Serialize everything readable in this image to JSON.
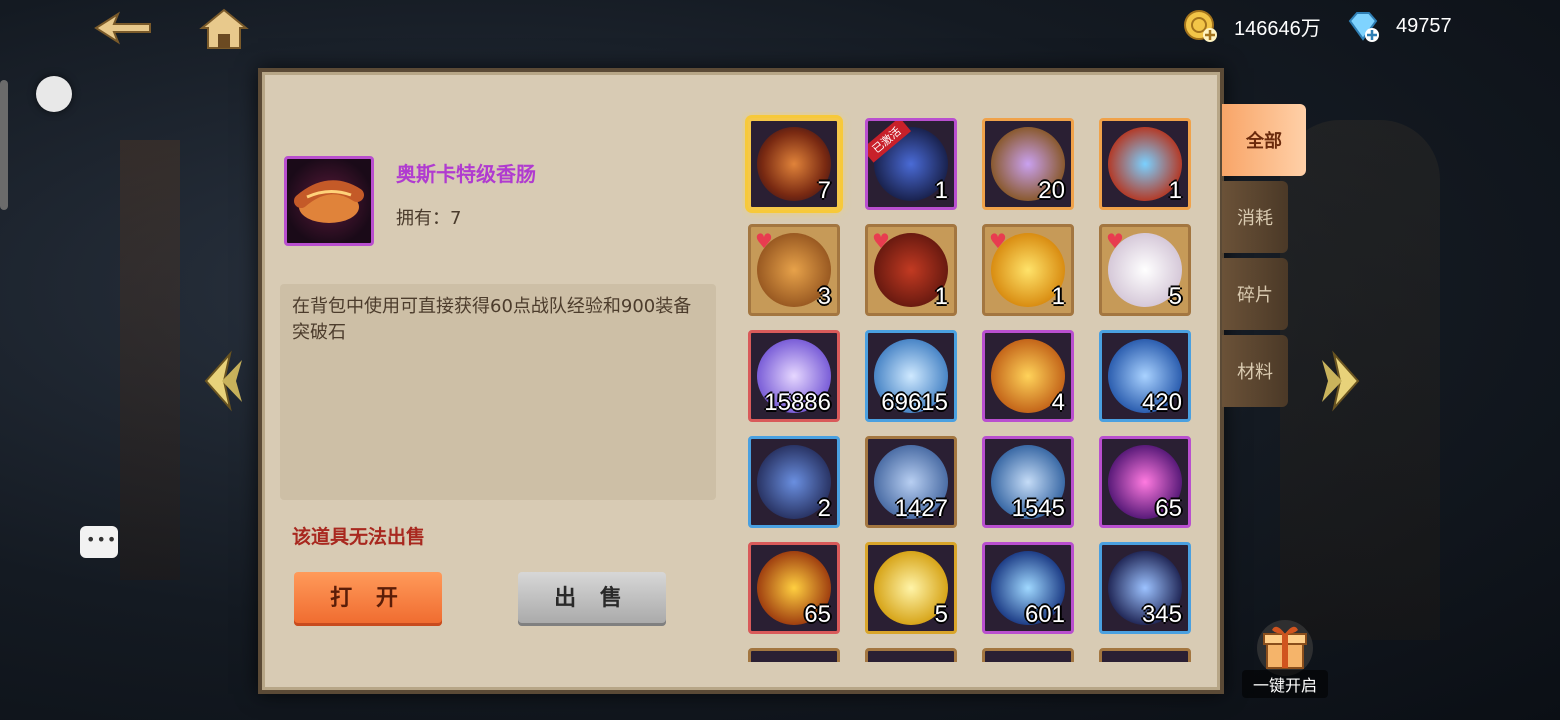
{
  "currency": {
    "gold": "146646万",
    "diamond": "49757"
  },
  "selected_item": {
    "name": "奥斯卡特级香肠",
    "owned_label": "拥有：7",
    "description": "在背包中使用可直接获得60点战队经验和900装备突破石",
    "sell_note": "该道具无法出售"
  },
  "actions": {
    "open": "打 开",
    "sell": "出 售"
  },
  "tabs": [
    "全部",
    "消耗",
    "碎片",
    "材料"
  ],
  "active_tab": "全部",
  "grid_items": [
    {
      "icon": "sausage-icon",
      "qty": "7",
      "heart": false,
      "selected": true
    },
    {
      "icon": "masked-hero-icon",
      "qty": "1",
      "heart": false,
      "badge": "已激活"
    },
    {
      "icon": "card-pack-icon",
      "qty": "20",
      "heart": false
    },
    {
      "icon": "magic-circle-icon",
      "qty": "1",
      "heart": false
    },
    {
      "icon": "roast-chicken-icon",
      "qty": "3",
      "heart": true
    },
    {
      "icon": "wine-jar-icon",
      "qty": "1",
      "heart": true
    },
    {
      "icon": "gold-orb-icon",
      "qty": "1",
      "heart": true
    },
    {
      "icon": "pearl-icon",
      "qty": "5",
      "heart": true
    },
    {
      "icon": "purple-crystal-icon",
      "qty": "15886",
      "heart": false
    },
    {
      "icon": "blue-crystal-icon",
      "qty": "69615",
      "heart": false
    },
    {
      "icon": "gold-secret-coin-icon",
      "qty": "4",
      "heart": false
    },
    {
      "icon": "blue-secret-coin-icon",
      "qty": "420",
      "heart": false
    },
    {
      "icon": "explore-badge-icon",
      "qty": "2",
      "heart": false
    },
    {
      "icon": "honor-badge-icon",
      "qty": "1427",
      "heart": false
    },
    {
      "icon": "merit-coin-icon",
      "qty": "1545",
      "heart": false
    },
    {
      "icon": "music-note-icon",
      "qty": "65",
      "heart": false
    },
    {
      "icon": "exp-book-icon",
      "qty": "65",
      "heart": false
    },
    {
      "icon": "kick-skill-icon",
      "qty": "5",
      "heart": false
    },
    {
      "icon": "fighter-skill-icon",
      "qty": "601",
      "heart": false
    },
    {
      "icon": "shadow-skill-icon",
      "qty": "345",
      "heart": false
    }
  ],
  "one_click_open": "一键开启"
}
